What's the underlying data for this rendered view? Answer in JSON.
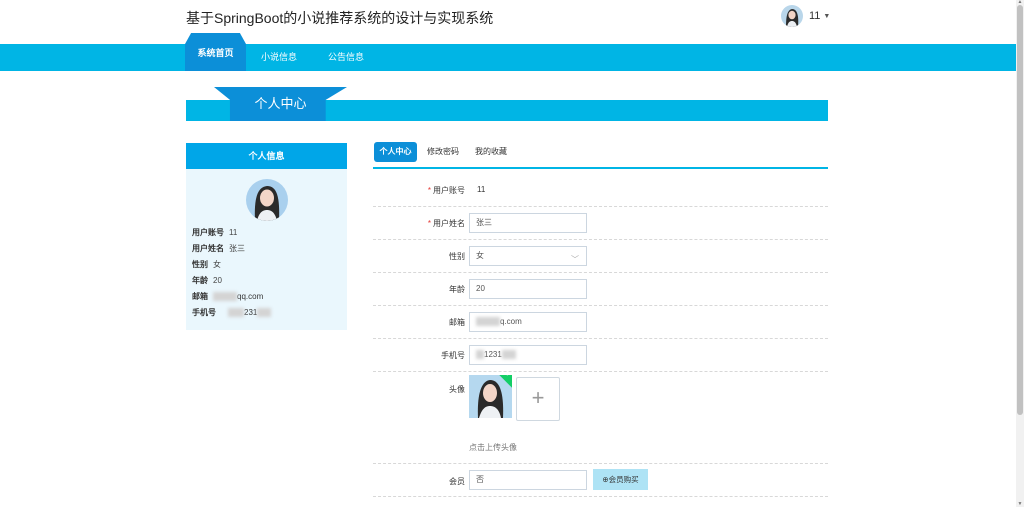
{
  "header": {
    "title": "基于SpringBoot的小说推荐系统的设计与实现系统",
    "username": "11"
  },
  "nav": {
    "items": [
      "系统首页",
      "小说信息",
      "公告信息"
    ]
  },
  "banner": {
    "title": "个人中心"
  },
  "profile_card": {
    "title": "个人信息",
    "rows": [
      {
        "label": "用户账号",
        "value": "11"
      },
      {
        "label": "用户姓名",
        "value": "张三"
      },
      {
        "label": "性别",
        "value": "女"
      },
      {
        "label": "年龄",
        "value": "20"
      },
      {
        "label": "邮箱",
        "value": "qq.com"
      },
      {
        "label": "手机号",
        "value": "231"
      }
    ]
  },
  "tabs": [
    "个人中心",
    "修改密码",
    "我的收藏"
  ],
  "form": {
    "account": {
      "label": "用户账号",
      "value": "11"
    },
    "name": {
      "label": "用户姓名",
      "value": "张三"
    },
    "gender": {
      "label": "性别",
      "value": "女"
    },
    "age": {
      "label": "年龄",
      "value": "20"
    },
    "email": {
      "label": "邮箱",
      "value": "q.com"
    },
    "phone": {
      "label": "手机号",
      "value": "1231"
    },
    "avatar": {
      "label": "头像",
      "hint": "点击上传头像",
      "plus": "+"
    },
    "member": {
      "label": "会员",
      "value": "否",
      "buy_label": "会员购买",
      "buy_icon": "⊕"
    }
  },
  "colors": {
    "primary": "#00b5e5",
    "accent": "#0c8fd8",
    "card_bg": "#eaf7fd"
  }
}
